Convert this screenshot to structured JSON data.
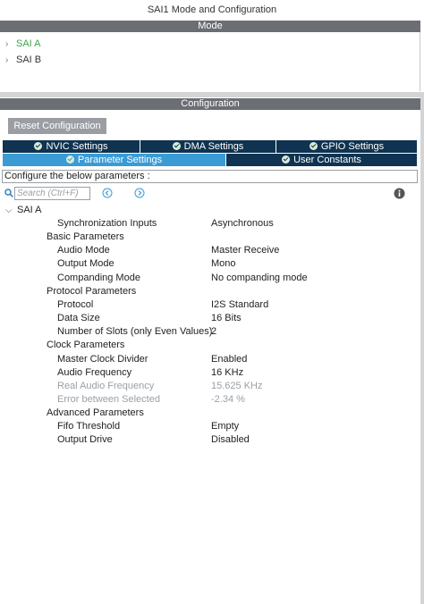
{
  "window": {
    "title": "SAI1 Mode and Configuration"
  },
  "mode": {
    "header": "Mode",
    "items": [
      {
        "label": "SAI A",
        "color": "#3aa64a"
      },
      {
        "label": "SAI B",
        "color": "#333333"
      }
    ]
  },
  "configuration": {
    "header": "Configuration",
    "reset_label": "Reset Configuration",
    "tabs": [
      {
        "label": "NVIC Settings",
        "active": false
      },
      {
        "label": "DMA Settings",
        "active": false
      },
      {
        "label": "GPIO Settings",
        "active": false
      },
      {
        "label": "Parameter Settings",
        "active": true
      },
      {
        "label": "User Constants",
        "active": false
      }
    ],
    "configure_text": "Configure the below parameters :",
    "search_placeholder": "Search (Ctrl+F)",
    "tree_root": "SAI A",
    "rows": [
      {
        "label": "Synchronization Inputs",
        "value": "Asynchronous",
        "type": "param"
      },
      {
        "label": "Basic Parameters",
        "value": "",
        "type": "group"
      },
      {
        "label": "Audio Mode",
        "value": "Master Receive",
        "type": "param"
      },
      {
        "label": "Output Mode",
        "value": "Mono",
        "type": "param"
      },
      {
        "label": "Companding Mode",
        "value": "No companding mode",
        "type": "param"
      },
      {
        "label": "Protocol Parameters",
        "value": "",
        "type": "group"
      },
      {
        "label": "Protocol",
        "value": "I2S Standard",
        "type": "param"
      },
      {
        "label": "Data Size",
        "value": "16 Bits",
        "type": "param"
      },
      {
        "label": "Number of Slots (only Even Values)",
        "value": "2",
        "type": "param"
      },
      {
        "label": "Clock Parameters",
        "value": "",
        "type": "group"
      },
      {
        "label": "Master Clock Divider",
        "value": "Enabled",
        "type": "param"
      },
      {
        "label": "Audio Frequency",
        "value": "16 KHz",
        "type": "param"
      },
      {
        "label": "Real Audio Frequency",
        "value": "15.625 KHz",
        "type": "disabled"
      },
      {
        "label": "Error between Selected",
        "value": "-2.34 %",
        "type": "disabled"
      },
      {
        "label": "Advanced Parameters",
        "value": "",
        "type": "group"
      },
      {
        "label": "Fifo Threshold",
        "value": "Empty",
        "type": "param"
      },
      {
        "label": "Output Drive",
        "value": "Disabled",
        "type": "param"
      }
    ]
  },
  "colors": {
    "section_bar": "#6b6f73",
    "tab_dark": "#0f3350",
    "tab_active": "#3a9bd5",
    "nav_arrow": "#3a9bd5",
    "mode_active": "#3aa64a",
    "disabled_text": "#9aa0a6"
  },
  "icons": {
    "search": "search-icon",
    "prev": "chevron-left-circle-icon",
    "next": "chevron-right-circle-icon",
    "info": "info-icon",
    "tab_check": "check-circle-icon",
    "expand": "chevron-right-icon",
    "collapse": "chevron-down-icon"
  }
}
